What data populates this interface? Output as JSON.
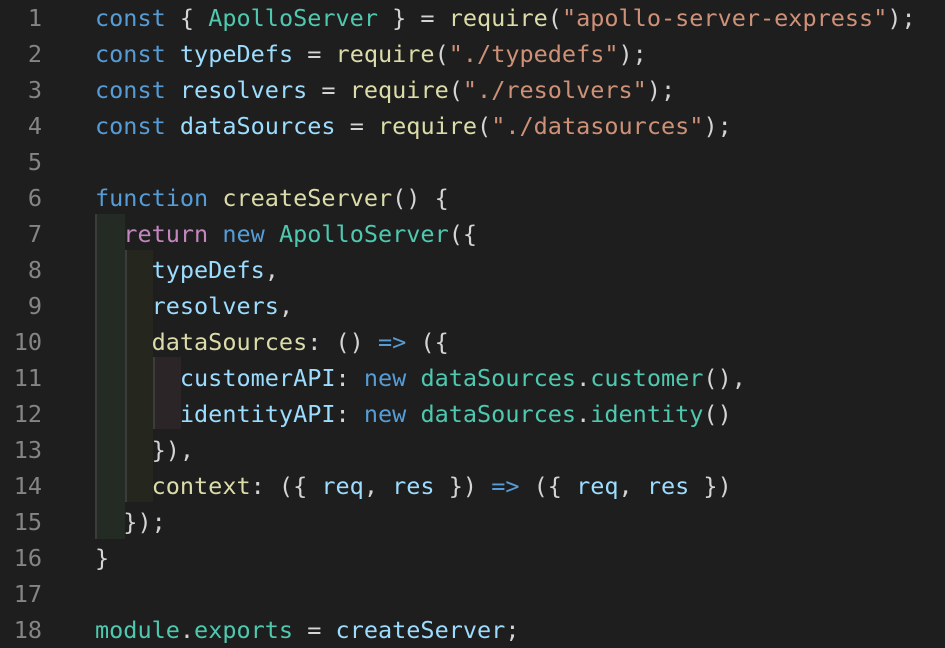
{
  "editor": {
    "language": "javascript",
    "theme_colors": {
      "background": "#1e1e1e",
      "line_number": "#858585",
      "keyword": "#569cd6",
      "control": "#c586c0",
      "type": "#4ec9b0",
      "function": "#dcdcaa",
      "string": "#ce9178",
      "variable": "#9cdcfe",
      "text": "#d4d4d4"
    },
    "lines": [
      {
        "n": "1",
        "tokens": [
          [
            "k",
            "const"
          ],
          [
            "p",
            " { "
          ],
          [
            "t",
            "ApolloServer"
          ],
          [
            "p",
            " } = "
          ],
          [
            "f",
            "require"
          ],
          [
            "p",
            "("
          ],
          [
            "s",
            "\"apollo-server-express\""
          ],
          [
            "p",
            ");"
          ]
        ]
      },
      {
        "n": "2",
        "tokens": [
          [
            "k",
            "const"
          ],
          [
            "p",
            " "
          ],
          [
            "v",
            "typeDefs"
          ],
          [
            "p",
            " = "
          ],
          [
            "f",
            "require"
          ],
          [
            "p",
            "("
          ],
          [
            "s",
            "\"./typedefs\""
          ],
          [
            "p",
            ");"
          ]
        ]
      },
      {
        "n": "3",
        "tokens": [
          [
            "k",
            "const"
          ],
          [
            "p",
            " "
          ],
          [
            "v",
            "resolvers"
          ],
          [
            "p",
            " = "
          ],
          [
            "f",
            "require"
          ],
          [
            "p",
            "("
          ],
          [
            "s",
            "\"./resolvers\""
          ],
          [
            "p",
            ");"
          ]
        ]
      },
      {
        "n": "4",
        "tokens": [
          [
            "k",
            "const"
          ],
          [
            "p",
            " "
          ],
          [
            "v",
            "dataSources"
          ],
          [
            "p",
            " = "
          ],
          [
            "f",
            "require"
          ],
          [
            "p",
            "("
          ],
          [
            "s",
            "\"./datasources\""
          ],
          [
            "p",
            ");"
          ]
        ]
      },
      {
        "n": "5",
        "tokens": []
      },
      {
        "n": "6",
        "tokens": [
          [
            "k",
            "function"
          ],
          [
            "p",
            " "
          ],
          [
            "f",
            "createServer"
          ],
          [
            "p",
            "() {"
          ]
        ]
      },
      {
        "n": "7",
        "tokens": [
          [
            "p",
            "  "
          ],
          [
            "kc",
            "return"
          ],
          [
            "p",
            " "
          ],
          [
            "k",
            "new"
          ],
          [
            "p",
            " "
          ],
          [
            "t",
            "ApolloServer"
          ],
          [
            "p",
            "({"
          ]
        ]
      },
      {
        "n": "8",
        "tokens": [
          [
            "p",
            "    "
          ],
          [
            "v",
            "typeDefs"
          ],
          [
            "p",
            ","
          ]
        ]
      },
      {
        "n": "9",
        "tokens": [
          [
            "p",
            "    "
          ],
          [
            "v",
            "resolvers"
          ],
          [
            "p",
            ","
          ]
        ]
      },
      {
        "n": "10",
        "tokens": [
          [
            "p",
            "    "
          ],
          [
            "f",
            "dataSources"
          ],
          [
            "p",
            ": () "
          ],
          [
            "k",
            "=>"
          ],
          [
            "p",
            " ({"
          ]
        ]
      },
      {
        "n": "11",
        "tokens": [
          [
            "p",
            "      "
          ],
          [
            "v",
            "customerAPI"
          ],
          [
            "p",
            ": "
          ],
          [
            "k",
            "new"
          ],
          [
            "p",
            " "
          ],
          [
            "t",
            "dataSources"
          ],
          [
            "p",
            "."
          ],
          [
            "t",
            "customer"
          ],
          [
            "p",
            "(),"
          ]
        ]
      },
      {
        "n": "12",
        "tokens": [
          [
            "p",
            "      "
          ],
          [
            "v",
            "identityAPI"
          ],
          [
            "p",
            ": "
          ],
          [
            "k",
            "new"
          ],
          [
            "p",
            " "
          ],
          [
            "t",
            "dataSources"
          ],
          [
            "p",
            "."
          ],
          [
            "t",
            "identity"
          ],
          [
            "p",
            "()"
          ]
        ]
      },
      {
        "n": "13",
        "tokens": [
          [
            "p",
            "    }),"
          ]
        ]
      },
      {
        "n": "14",
        "tokens": [
          [
            "p",
            "    "
          ],
          [
            "f",
            "context"
          ],
          [
            "p",
            ": ({ "
          ],
          [
            "v",
            "req"
          ],
          [
            "p",
            ", "
          ],
          [
            "v",
            "res"
          ],
          [
            "p",
            " }) "
          ],
          [
            "k",
            "=>"
          ],
          [
            "p",
            " ({ "
          ],
          [
            "v",
            "req"
          ],
          [
            "p",
            ", "
          ],
          [
            "v",
            "res"
          ],
          [
            "p",
            " })"
          ]
        ]
      },
      {
        "n": "15",
        "tokens": [
          [
            "p",
            "  });"
          ]
        ]
      },
      {
        "n": "16",
        "tokens": [
          [
            "p",
            "}"
          ]
        ]
      },
      {
        "n": "17",
        "tokens": []
      },
      {
        "n": "18",
        "tokens": [
          [
            "t",
            "module"
          ],
          [
            "p",
            "."
          ],
          [
            "t",
            "exports"
          ],
          [
            "p",
            " = "
          ],
          [
            "v",
            "createServer"
          ],
          [
            "p",
            ";"
          ]
        ]
      }
    ]
  }
}
